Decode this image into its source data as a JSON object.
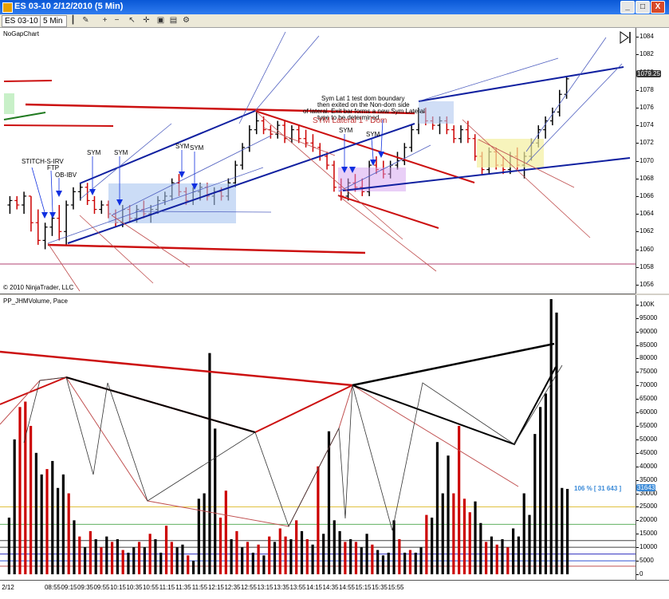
{
  "window": {
    "title": "ES 03-10  2/12/2010 (5 Min)",
    "min_label": "_",
    "max_label": "□",
    "close_label": "X"
  },
  "toolbar": {
    "instrument": "ES 03-10",
    "interval": "5 Min"
  },
  "price_panel": {
    "label": "NoGapChart",
    "copyright": "© 2010 NinjaTrader, LLC",
    "last_price": "1079.25"
  },
  "volume_panel": {
    "label": "PP_JHMVolume, Pace",
    "pace_label": "106 % [ 31 643 ]",
    "last_volume": "31643"
  },
  "annotations": {
    "stitch": "STITCH-S-IRV",
    "ftp": "FTP",
    "obibv": "OB-IBV",
    "sym": "SYM",
    "note1": "Sym Lat 1 test dom boundary",
    "note2": "then exited on the Non-dom side",
    "note3": "of lateral.  Exit bar forms a new Sym Lateral",
    "note4": "type to be determined",
    "sym_lateral": "SYM Lateral 1 - Dom"
  },
  "colors": {
    "up": "#000000",
    "down": "#cc0000",
    "channel_blue": "#1020a0",
    "channel_red": "#cc1010",
    "marker": "#1030e0"
  },
  "chart_data": [
    {
      "type": "ohlc",
      "title": "NoGapChart",
      "ylim": [
        1055,
        1085
      ],
      "y_ticks": [
        1056,
        1058,
        1060,
        1062,
        1064,
        1066,
        1068,
        1070,
        1072,
        1074,
        1076,
        1078,
        1080,
        1082,
        1084
      ],
      "x_ticks": [
        "2/12",
        "08:55",
        "09:15",
        "09:35",
        "09:55",
        "10:15",
        "10:35",
        "10:55",
        "11:15",
        "11:35",
        "11:55",
        "12:15",
        "12:35",
        "12:55",
        "13:15",
        "13:35",
        "13:55",
        "14:15",
        "14:35",
        "14:55",
        "15:15",
        "15:35",
        "15:55"
      ],
      "bars": [
        [
          1065,
          1066,
          1064,
          1065.5
        ],
        [
          1065.5,
          1066,
          1064.5,
          1065
        ],
        [
          1065,
          1066.5,
          1064,
          1066
        ],
        [
          1066,
          1066,
          1062,
          1063
        ],
        [
          1063,
          1064.5,
          1060.5,
          1061
        ],
        [
          1061,
          1063,
          1060,
          1062.5
        ],
        [
          1062.5,
          1064,
          1061.5,
          1063.5
        ],
        [
          1063.5,
          1065,
          1061,
          1062
        ],
        [
          1062,
          1065.5,
          1060.5,
          1065
        ],
        [
          1065,
          1067,
          1064.5,
          1066.5
        ],
        [
          1066.5,
          1067.5,
          1065.5,
          1067
        ],
        [
          1067,
          1067.5,
          1065,
          1065.5
        ],
        [
          1065.5,
          1066,
          1064,
          1064.5
        ],
        [
          1064.5,
          1065.5,
          1064,
          1065
        ],
        [
          1065,
          1065.5,
          1063.5,
          1064
        ],
        [
          1064,
          1064.5,
          1062.5,
          1063
        ],
        [
          1063,
          1065,
          1062.5,
          1064.5
        ],
        [
          1064.5,
          1065,
          1063,
          1063.5
        ],
        [
          1063.5,
          1065,
          1063,
          1064.5
        ],
        [
          1064.5,
          1065.5,
          1063.5,
          1064
        ],
        [
          1064,
          1065,
          1063,
          1064.5
        ],
        [
          1064.5,
          1066,
          1064,
          1065.5
        ],
        [
          1065.5,
          1066.5,
          1065,
          1066
        ],
        [
          1066,
          1068,
          1065.5,
          1067.5
        ],
        [
          1067.5,
          1068.5,
          1066,
          1066.5
        ],
        [
          1066.5,
          1067,
          1065,
          1065.5
        ],
        [
          1065.5,
          1067,
          1065,
          1066.5
        ],
        [
          1066.5,
          1067.5,
          1065.5,
          1067
        ],
        [
          1067,
          1067.5,
          1065.5,
          1066
        ],
        [
          1066,
          1067,
          1065,
          1066.5
        ],
        [
          1066.5,
          1067,
          1065.5,
          1066
        ],
        [
          1066,
          1068,
          1065.5,
          1067.5
        ],
        [
          1067.5,
          1070,
          1067,
          1069.5
        ],
        [
          1069.5,
          1072,
          1069,
          1071.5
        ],
        [
          1071.5,
          1074,
          1071,
          1073.5
        ],
        [
          1073.5,
          1075.5,
          1073,
          1074.5
        ],
        [
          1074.5,
          1075,
          1073,
          1073.5
        ],
        [
          1073.5,
          1074,
          1072.5,
          1073
        ],
        [
          1073,
          1074.5,
          1072.5,
          1074
        ],
        [
          1074,
          1074.5,
          1072,
          1072.5
        ],
        [
          1072.5,
          1074,
          1072,
          1073.5
        ],
        [
          1073.5,
          1074,
          1072,
          1072.5
        ],
        [
          1072.5,
          1073.5,
          1071.5,
          1072
        ],
        [
          1072,
          1073,
          1071,
          1071.5
        ],
        [
          1071.5,
          1072,
          1070,
          1070.5
        ],
        [
          1070.5,
          1071,
          1069,
          1069.5
        ],
        [
          1069.5,
          1070,
          1066.5,
          1067
        ],
        [
          1067,
          1068,
          1065.5,
          1066
        ],
        [
          1066,
          1068,
          1065.5,
          1067.5
        ],
        [
          1067.5,
          1068.5,
          1066.5,
          1067
        ],
        [
          1067,
          1068,
          1066,
          1066.5
        ],
        [
          1066.5,
          1070,
          1066,
          1069.5
        ],
        [
          1069.5,
          1070.5,
          1068.5,
          1069
        ],
        [
          1069,
          1070,
          1068,
          1068.5
        ],
        [
          1068.5,
          1070,
          1068,
          1069.5
        ],
        [
          1069.5,
          1071,
          1069,
          1070
        ],
        [
          1070,
          1072,
          1069.5,
          1071.5
        ],
        [
          1071.5,
          1074,
          1071,
          1073.5
        ],
        [
          1073.5,
          1076,
          1073,
          1075.5
        ],
        [
          1075.5,
          1076,
          1074,
          1074.5
        ],
        [
          1074.5,
          1075,
          1073.5,
          1074
        ],
        [
          1074,
          1075,
          1073,
          1074.5
        ],
        [
          1074.5,
          1075,
          1073,
          1073.5
        ],
        [
          1073.5,
          1074,
          1072,
          1072.5
        ],
        [
          1072.5,
          1074,
          1072,
          1073.5
        ],
        [
          1073.5,
          1074.5,
          1072,
          1072.5
        ],
        [
          1072.5,
          1073,
          1070,
          1070.5
        ],
        [
          1070.5,
          1071,
          1068.5,
          1069
        ],
        [
          1069,
          1071.5,
          1068.5,
          1071
        ],
        [
          1071,
          1071.5,
          1069,
          1069.5
        ],
        [
          1069.5,
          1070.5,
          1068.5,
          1069
        ],
        [
          1069,
          1071,
          1068.5,
          1070.5
        ],
        [
          1070.5,
          1071.5,
          1069,
          1069.5
        ],
        [
          1069.5,
          1071,
          1068,
          1070.5
        ],
        [
          1070.5,
          1072.5,
          1070,
          1072
        ],
        [
          1072,
          1074,
          1071.5,
          1073.5
        ],
        [
          1073.5,
          1075,
          1072.5,
          1074.5
        ],
        [
          1074.5,
          1076,
          1074,
          1075.5
        ],
        [
          1075.5,
          1078,
          1075,
          1077.5
        ],
        [
          1077.5,
          1079.5,
          1077,
          1079.25
        ]
      ]
    },
    {
      "type": "bar",
      "title": "PP_JHMVolume, Pace",
      "ylim": [
        0,
        102000
      ],
      "y_ticks": [
        0,
        5000,
        10000,
        15000,
        20000,
        25000,
        30000,
        35000,
        40000,
        45000,
        50000,
        55000,
        60000,
        65000,
        70000,
        75000,
        80000,
        85000,
        90000,
        95000,
        100000
      ],
      "y_tick_labels": [
        "0",
        "5000",
        "10000",
        "15000",
        "20000",
        "25000",
        "30000",
        "35000",
        "40000",
        "45000",
        "50000",
        "55000",
        "60000",
        "65000",
        "70000",
        "75000",
        "80000",
        "85000",
        "90000",
        "95000",
        "100K"
      ],
      "values": [
        21000,
        50000,
        62000,
        64000,
        55000,
        45000,
        37000,
        39000,
        42000,
        32000,
        37000,
        30000,
        20000,
        14000,
        10000,
        16000,
        13000,
        10000,
        14000,
        12000,
        13000,
        9000,
        8000,
        10000,
        12000,
        10000,
        15000,
        13000,
        8000,
        18000,
        12000,
        10000,
        11000,
        7000,
        5000,
        28000,
        30000,
        82000,
        54000,
        21000,
        31000,
        13000,
        16000,
        10000,
        12000,
        8000,
        11000,
        7000,
        14000,
        12000,
        17000,
        14000,
        13000,
        20000,
        16000,
        13000,
        11000,
        40000,
        15000,
        53000,
        20000,
        16000,
        12000,
        13000,
        12000,
        10000,
        15000,
        11000,
        9000,
        7000,
        8000,
        20000,
        13000,
        8000,
        9000,
        8000,
        10000,
        22000,
        21000,
        49000,
        30000,
        44000,
        30000,
        55000,
        28000,
        23000,
        27000,
        19000,
        12000,
        14000,
        11000,
        13000,
        10000,
        17000,
        14000,
        30000,
        22000,
        52000,
        62000,
        67000,
        102000,
        97000,
        32000,
        31643
      ],
      "down": [
        0,
        0,
        1,
        1,
        1,
        0,
        0,
        1,
        0,
        0,
        0,
        1,
        0,
        1,
        0,
        1,
        0,
        1,
        0,
        1,
        0,
        1,
        0,
        0,
        1,
        0,
        1,
        0,
        0,
        1,
        1,
        0,
        0,
        1,
        0,
        0,
        0,
        0,
        0,
        1,
        1,
        0,
        1,
        0,
        1,
        0,
        1,
        0,
        1,
        0,
        1,
        1,
        0,
        1,
        0,
        1,
        0,
        1,
        0,
        0,
        0,
        0,
        1,
        0,
        1,
        0,
        0,
        1,
        0,
        0,
        0,
        0,
        1,
        0,
        1,
        0,
        0,
        1,
        0,
        0,
        0,
        0,
        1,
        1,
        1,
        1,
        0,
        0,
        1,
        0,
        1,
        0,
        1,
        0,
        0,
        0,
        0,
        0,
        0,
        0,
        0,
        0,
        0,
        0
      ],
      "reference_levels": [
        {
          "value": 25000,
          "color": "#e0c040"
        },
        {
          "value": 18500,
          "color": "#60b060"
        },
        {
          "value": 12500,
          "color": "#404040"
        },
        {
          "value": 10000,
          "color": "#404040"
        },
        {
          "value": 7500,
          "color": "#3030c0"
        },
        {
          "value": 5000,
          "color": "#3050d0"
        },
        {
          "value": 3000,
          "color": "#c05050"
        }
      ]
    }
  ]
}
